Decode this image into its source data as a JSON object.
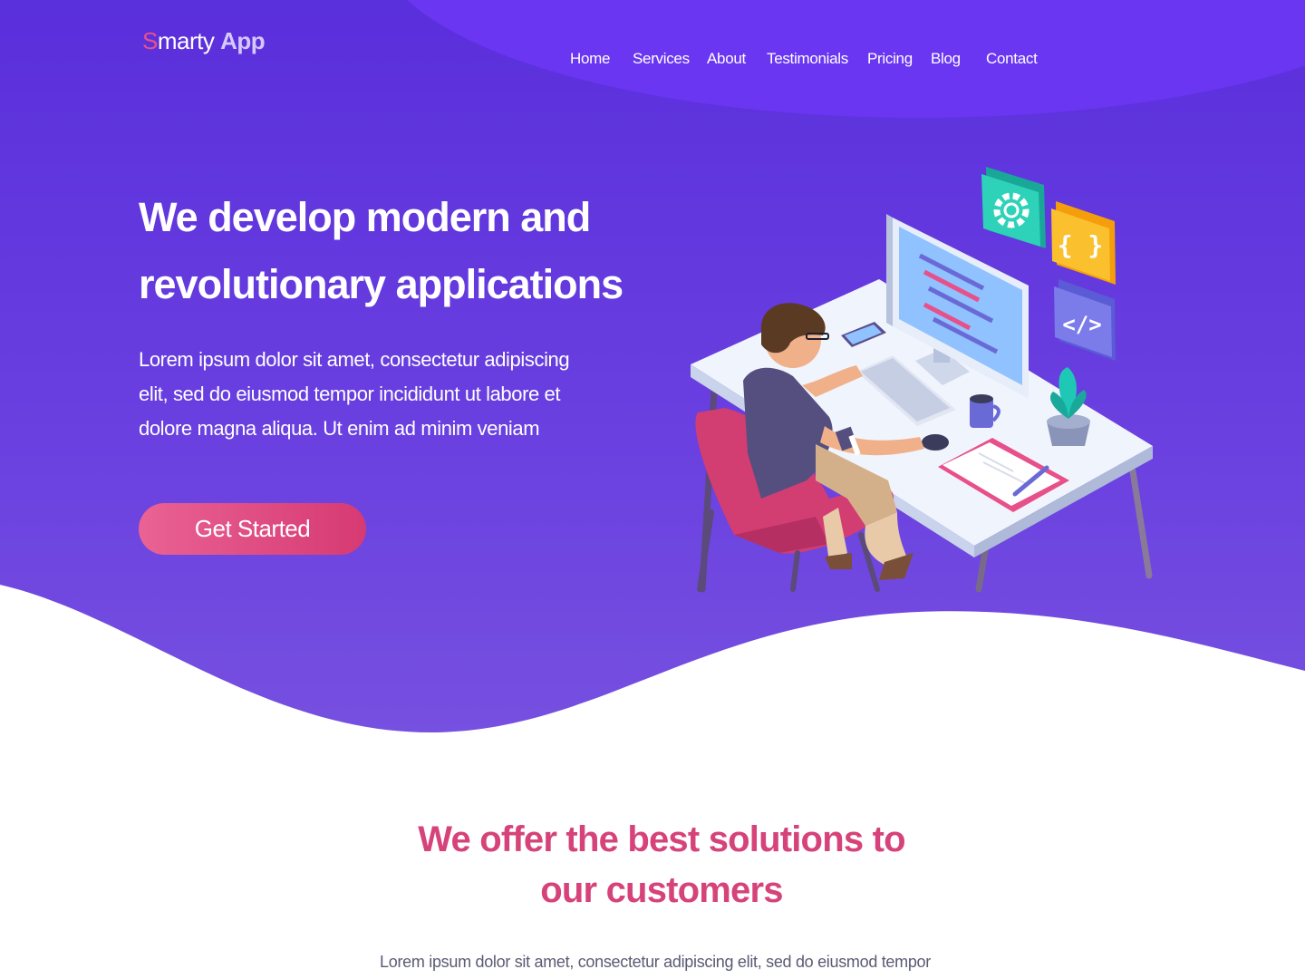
{
  "brand": {
    "s": "S",
    "marty": "marty",
    "app": "App"
  },
  "nav": {
    "items": [
      {
        "label": "Home"
      },
      {
        "label": "Services"
      },
      {
        "label": "About"
      },
      {
        "label": "Testimonials"
      },
      {
        "label": "Pricing"
      },
      {
        "label": "Blog"
      },
      {
        "label": "Contact"
      }
    ]
  },
  "hero": {
    "title_line1": "We develop modern and",
    "title_line2": "revolutionary applications",
    "lead_line1": "Lorem ipsum dolor sit amet, consectetur adipiscing",
    "lead_line2": "elit, sed do eiusmod tempor incididunt ut labore et",
    "lead_line3": "dolore magna aliqua. Ut enim ad minim veniam",
    "cta_label": "Get Started"
  },
  "solutions": {
    "title_line1": "We offer the best solutions to",
    "title_line2": "our customers",
    "text": "Lorem ipsum dolor sit amet, consectetur adipiscing elit, sed do eiusmod tempor"
  },
  "colors": {
    "hero_purple": "#5a2fdc",
    "accent_pink": "#d6437a",
    "nav_text": "#ffffff"
  },
  "icons": [
    "gear-icon",
    "braces-icon",
    "code-icon"
  ]
}
